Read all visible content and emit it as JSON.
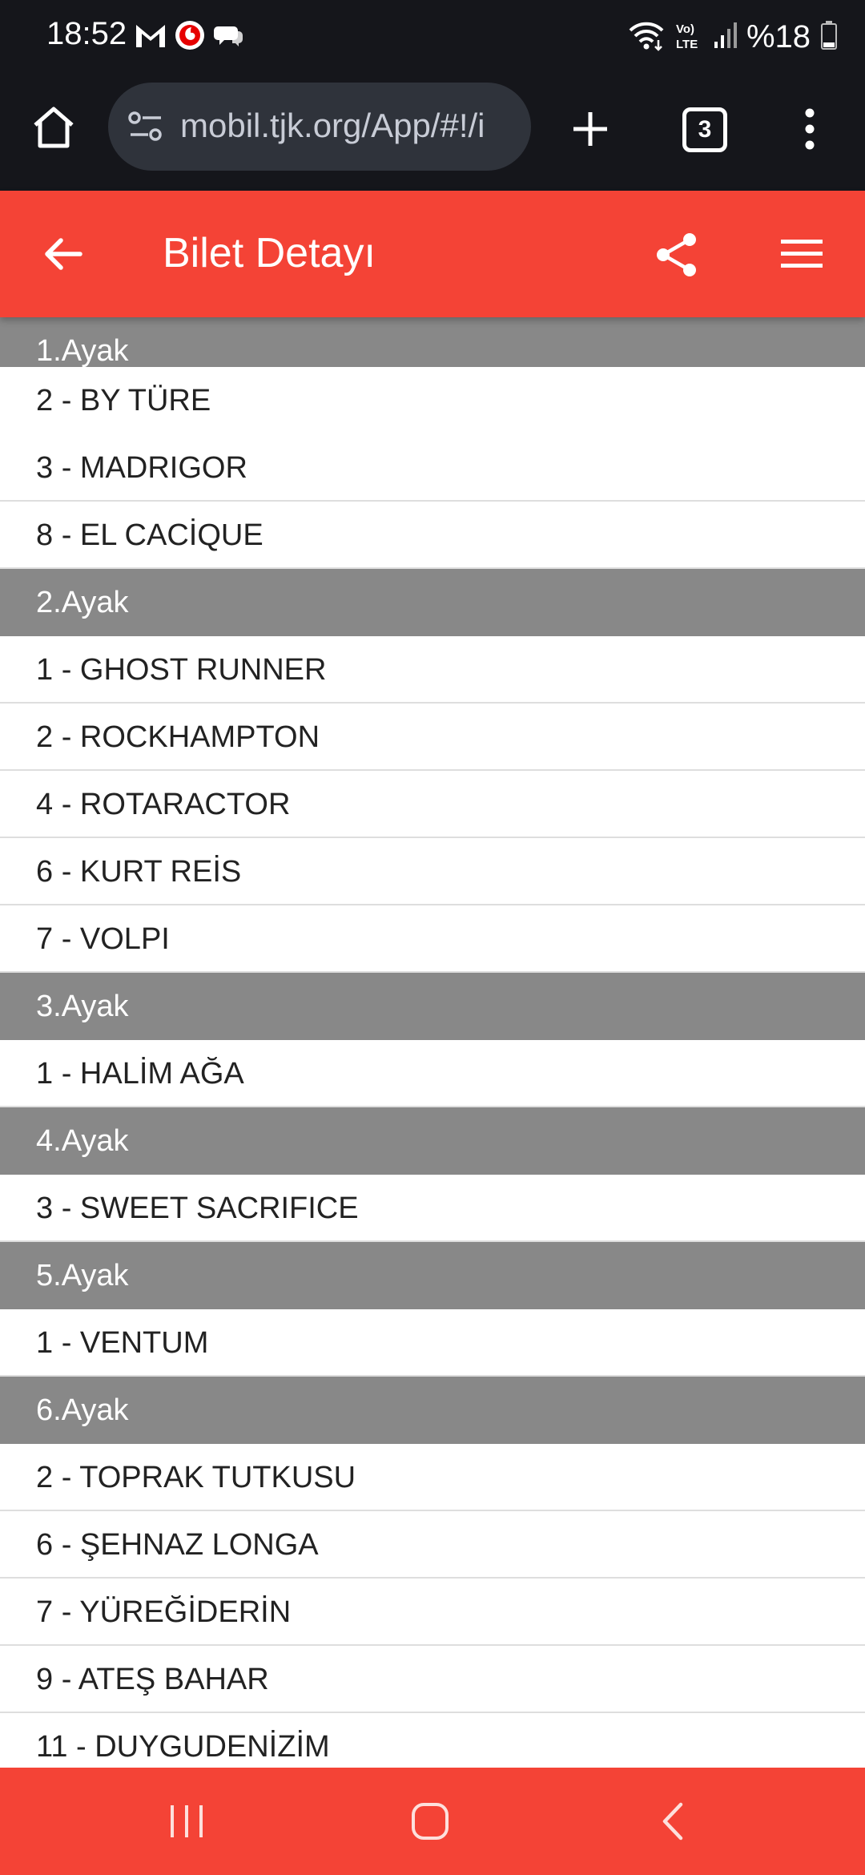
{
  "status_bar": {
    "time": "18:52",
    "battery": "%18"
  },
  "browser": {
    "url": "mobil.tjk.org/App/#!/i",
    "tab_count": "3"
  },
  "app_bar": {
    "title": "Bilet Detayı"
  },
  "legs": [
    {
      "title": "1.Ayak",
      "horses": [
        "2 - BY TÜRE",
        "3 - MADRIGOR",
        "8 - EL CACİQUE"
      ]
    },
    {
      "title": "2.Ayak",
      "horses": [
        "1 - GHOST RUNNER",
        "2 - ROCKHAMPTON",
        "4 - ROTARACTOR",
        "6 - KURT REİS",
        "7 - VOLPI"
      ]
    },
    {
      "title": "3.Ayak",
      "horses": [
        "1 - HALİM AĞA"
      ]
    },
    {
      "title": "4.Ayak",
      "horses": [
        "3 - SWEET SACRIFICE"
      ]
    },
    {
      "title": "5.Ayak",
      "horses": [
        "1 - VENTUM"
      ]
    },
    {
      "title": "6.Ayak",
      "horses": [
        "2 - TOPRAK TUTKUSU",
        "6 - ŞEHNAZ LONGA",
        "7 - YÜREĞİDERİN",
        "9 - ATEŞ BAHAR",
        "11 - DUYGUDENİZİM"
      ]
    }
  ],
  "colors": {
    "accent": "#f44336",
    "header_gray": "#888888",
    "chrome": "#15161b"
  }
}
